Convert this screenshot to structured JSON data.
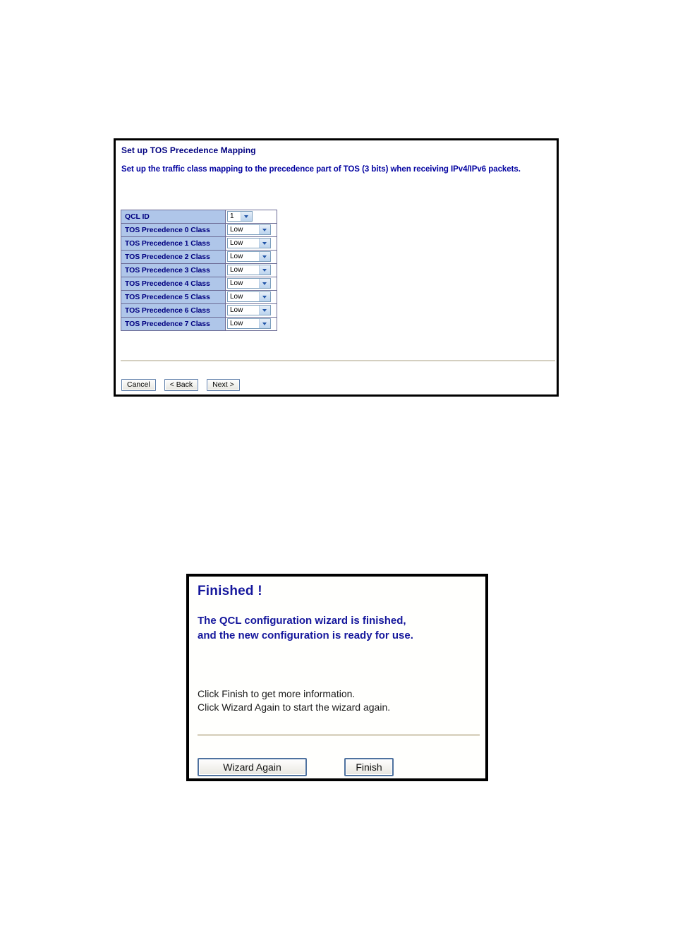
{
  "panel_tos": {
    "title": "Set up TOS Precedence Mapping",
    "description": "Set up the traffic class mapping to the precedence part of TOS (3 bits) when receiving IPv4/IPv6 packets.",
    "table": {
      "rows": [
        {
          "label": "QCL ID",
          "value": "1",
          "kind": "narrow"
        },
        {
          "label": "TOS Precedence 0 Class",
          "value": "Low",
          "kind": "wide"
        },
        {
          "label": "TOS Precedence 1 Class",
          "value": "Low",
          "kind": "wide"
        },
        {
          "label": "TOS Precedence 2 Class",
          "value": "Low",
          "kind": "wide"
        },
        {
          "label": "TOS Precedence 3 Class",
          "value": "Low",
          "kind": "wide"
        },
        {
          "label": "TOS Precedence 4 Class",
          "value": "Low",
          "kind": "wide"
        },
        {
          "label": "TOS Precedence 5 Class",
          "value": "Low",
          "kind": "wide"
        },
        {
          "label": "TOS Precedence 6 Class",
          "value": "Low",
          "kind": "wide"
        },
        {
          "label": "TOS Precedence 7 Class",
          "value": "Low",
          "kind": "wide"
        }
      ]
    },
    "buttons": {
      "cancel": "Cancel",
      "back": "< Back",
      "next": "Next >"
    }
  },
  "panel_finish": {
    "heading": "Finished !",
    "message_line_1": "The QCL configuration wizard is finished,",
    "message_line_2": "and the new configuration is ready for use.",
    "instruction_line_1": "Click Finish to get more information.",
    "instruction_line_2": "Click Wizard Again to start the wizard again.",
    "buttons": {
      "wizard_again": "Wizard Again",
      "finish": "Finish"
    }
  },
  "colors": {
    "heading_navy": "#000080",
    "finish_blue": "#15179c",
    "table_label_bg": "#afc6e9",
    "divider": "#d4cfc0",
    "panel_border": "#000000"
  }
}
